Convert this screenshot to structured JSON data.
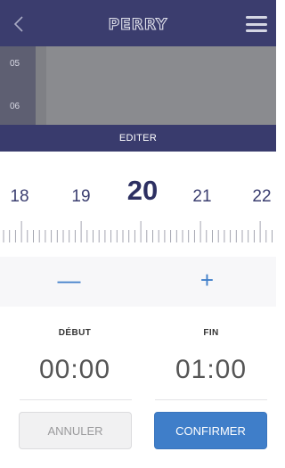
{
  "header": {
    "logo_text": "PERRY",
    "back_icon": "chevron-left-icon",
    "menu_icon": "hamburger-menu-icon"
  },
  "schedule": {
    "hours": [
      "05",
      "06"
    ]
  },
  "edit_bar": {
    "label": "EDITER"
  },
  "picker": {
    "values": [
      "18",
      "19",
      "20",
      "21",
      "22"
    ],
    "selected": "20"
  },
  "controls": {
    "minus": "—",
    "plus": "+"
  },
  "times": {
    "start_label": "DÉBUT",
    "start_value": "00:00",
    "end_label": "FIN",
    "end_value": "01:00"
  },
  "actions": {
    "cancel": "ANNULER",
    "confirm": "CONFIRMER"
  },
  "colors": {
    "header": "#3b3d6e",
    "accent": "#3f7ec9"
  }
}
